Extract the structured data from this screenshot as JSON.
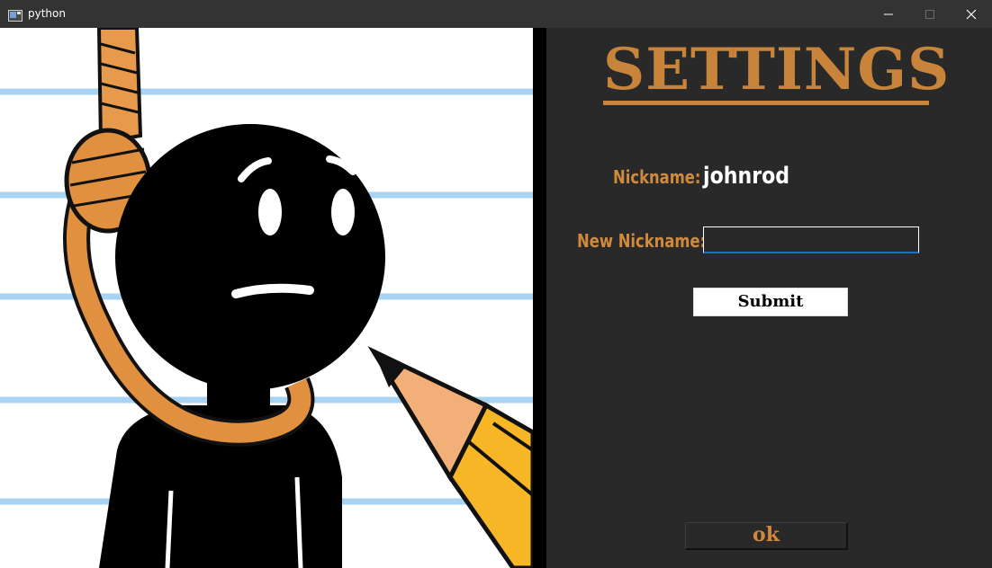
{
  "window": {
    "title": "python"
  },
  "settings": {
    "title": "SETTINGS",
    "nickname_label": "Nickname:",
    "nickname_value": "johnrod",
    "new_nickname_label": "New Nickname:",
    "new_nickname_value": "",
    "submit_label": "Submit",
    "ok_label": "ok"
  },
  "colors": {
    "accent": "#c8843a",
    "background": "#292929",
    "titlebar": "#333333",
    "input_focus": "#1f6fc6"
  },
  "icons": {
    "app": "python-window-icon",
    "minimize": "minimize-icon",
    "maximize": "maximize-icon",
    "close": "close-icon",
    "illustration": "hangman-stickman-with-pencil"
  }
}
